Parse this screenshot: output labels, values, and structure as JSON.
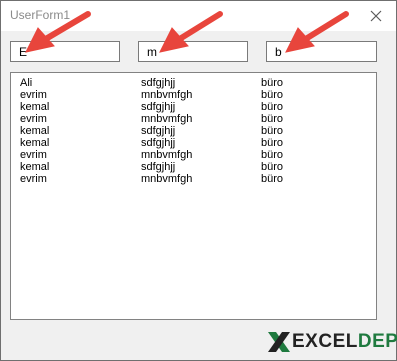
{
  "window": {
    "title": "UserForm1"
  },
  "filters": {
    "col1": "E",
    "col2": "m",
    "col3": "b"
  },
  "list": {
    "rows": [
      [
        "Ali",
        "sdfgjhjj",
        "büro"
      ],
      [
        "evrim",
        "mnbvmfgh",
        "büro"
      ],
      [
        "kemal",
        "sdfgjhjj",
        "büro"
      ],
      [
        "evrim",
        "mnbvmfgh",
        "büro"
      ],
      [
        "kemal",
        "sdfgjhjj",
        "büro"
      ],
      [
        "kemal",
        "sdfgjhjj",
        "büro"
      ],
      [
        "evrim",
        "mnbvmfgh",
        "büro"
      ],
      [
        "kemal",
        "sdfgjhjj",
        "büro"
      ],
      [
        "evrim",
        "mnbvmfgh",
        "büro"
      ]
    ]
  },
  "logo": {
    "part1": "EXCEL",
    "part2": "DEPO"
  },
  "icons": {
    "close": "close-icon",
    "arrow": "red-arrow-annotation",
    "logo_mark": "x-logo-mark"
  },
  "colors": {
    "arrow": "#e8453c",
    "logo_green": "#1f7a3f"
  }
}
